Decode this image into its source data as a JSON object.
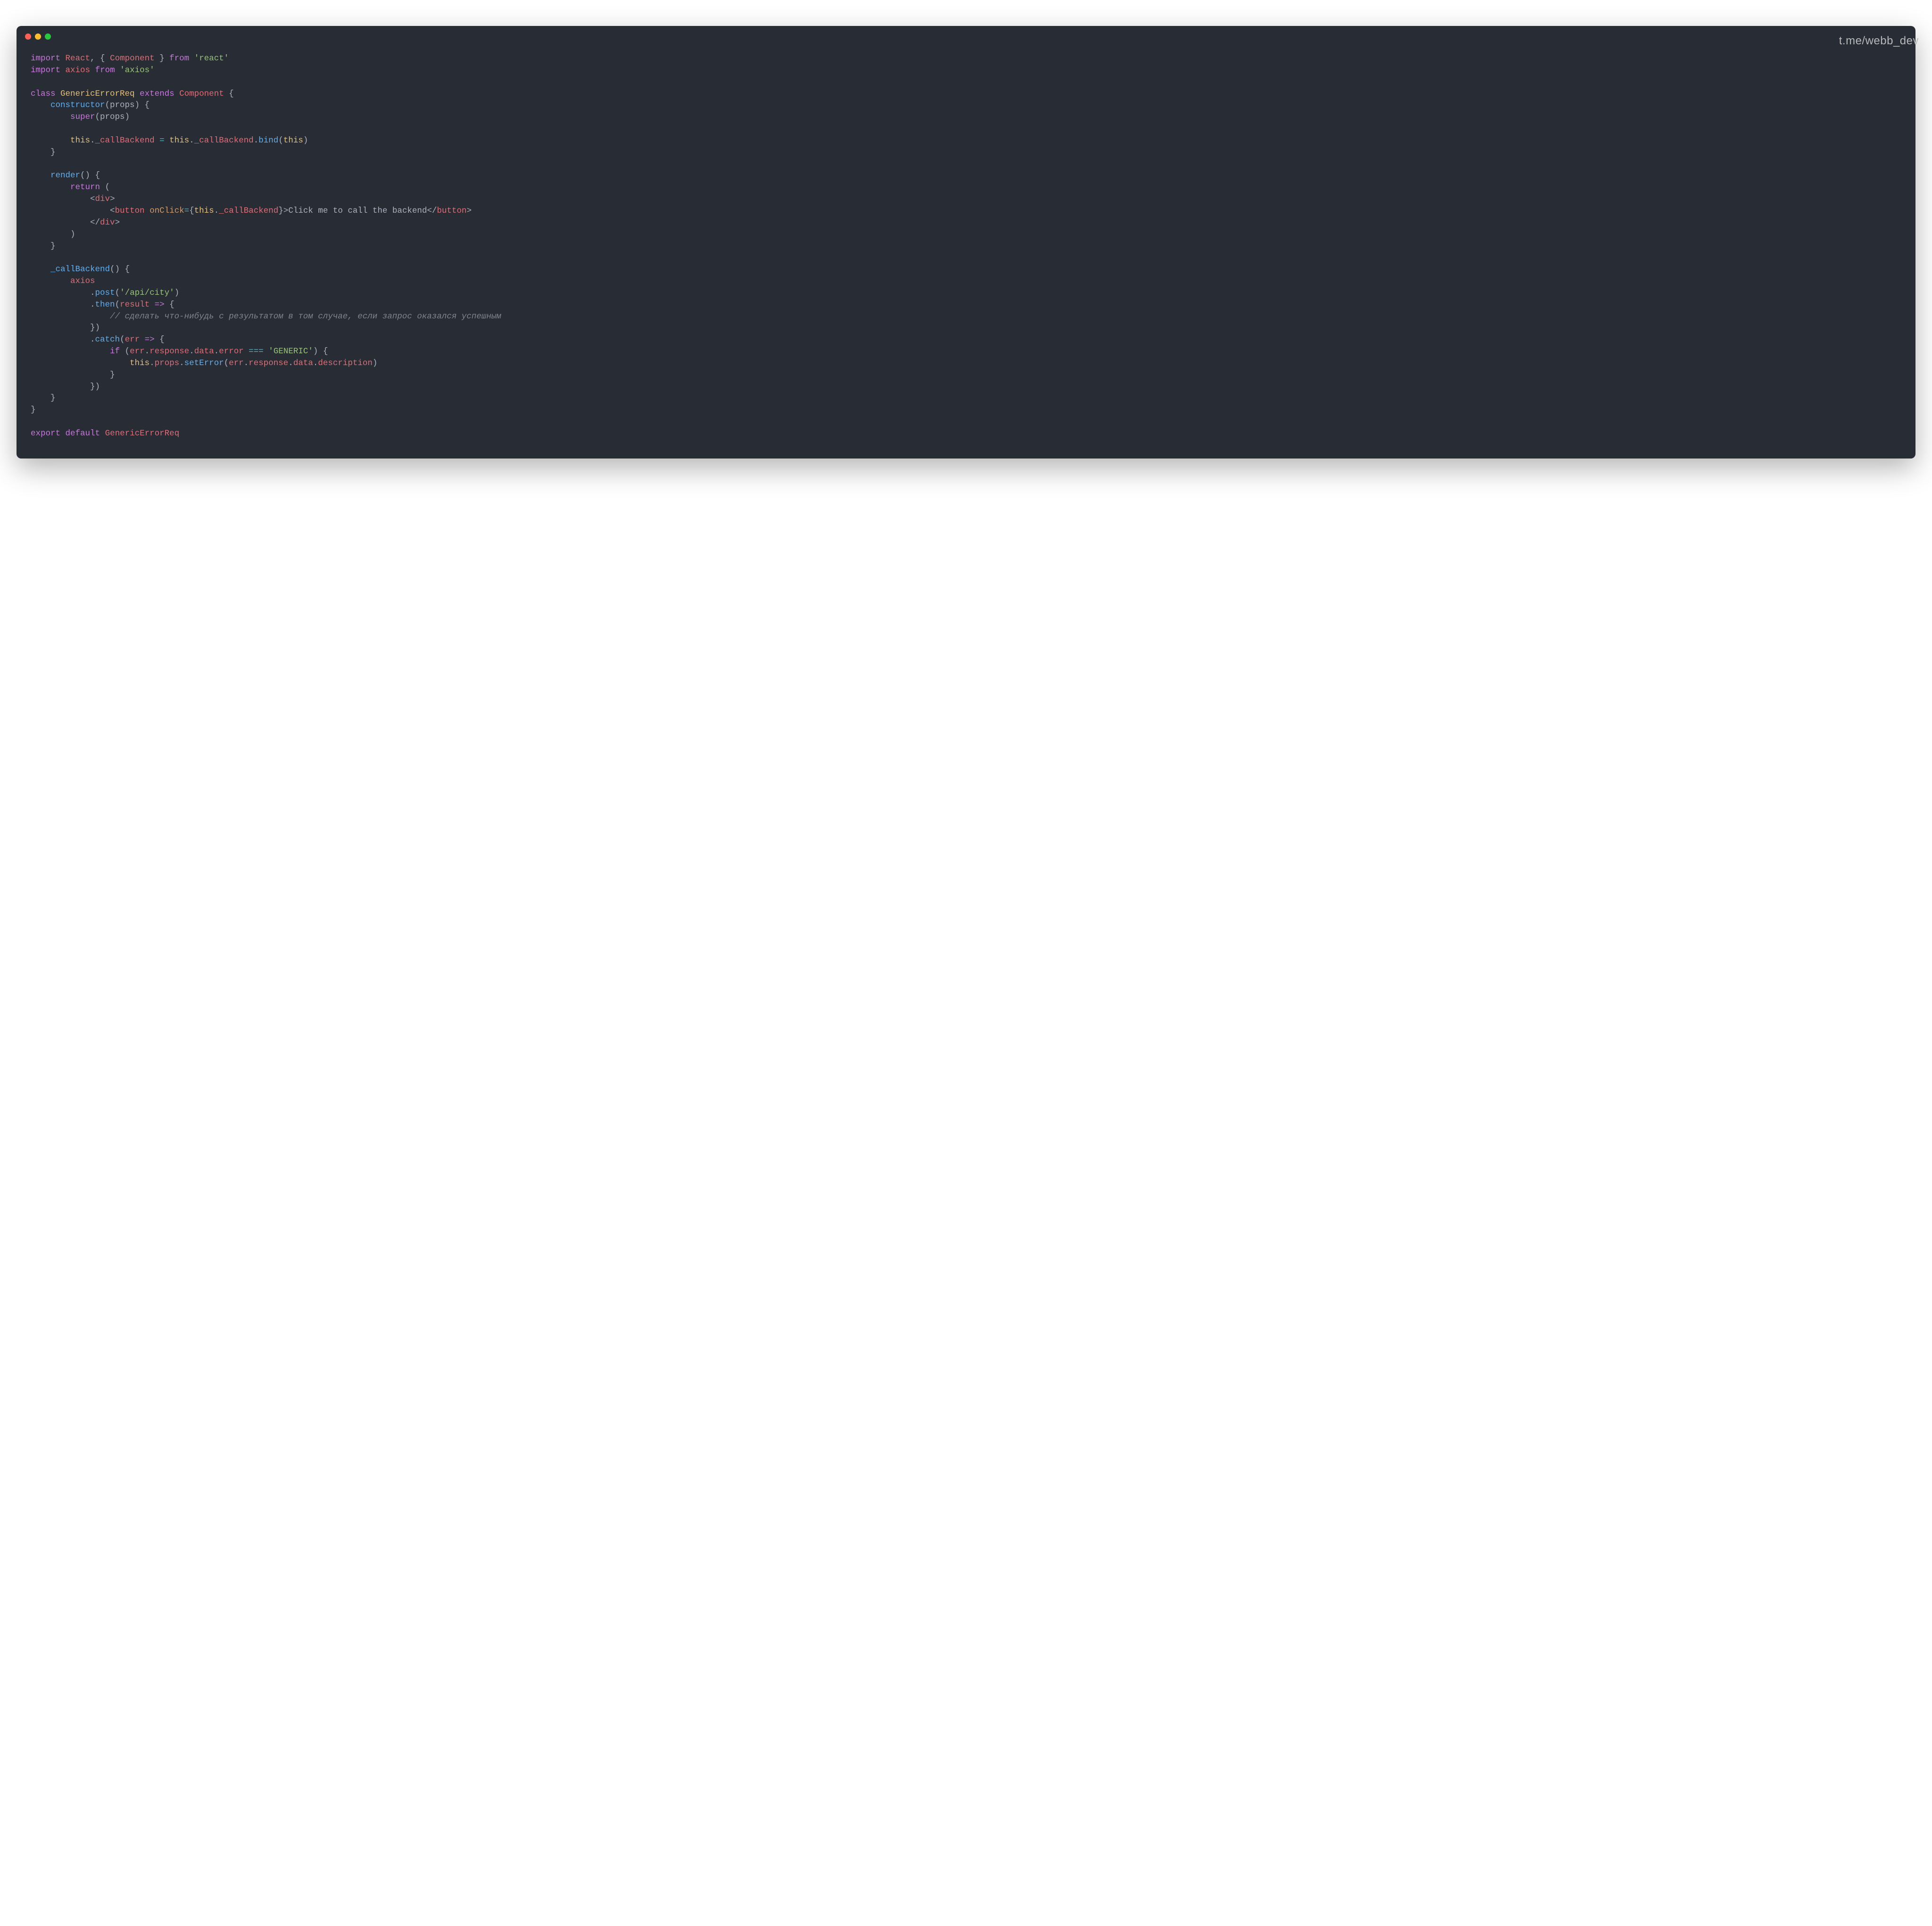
{
  "watermark": "t.me/webb_dev",
  "code": {
    "l1_import": "import",
    "l1_react": "React",
    "l1_comma": ", { ",
    "l1_component": "Component",
    "l1_brace_close": " } ",
    "l1_from": "from",
    "l1_react_str": "'react'",
    "l2_import": "import",
    "l2_axios": "axios",
    "l2_from": "from",
    "l2_axios_str": "'axios'",
    "l4_class": "class",
    "l4_name": "GenericErrorReq",
    "l4_extends": "extends",
    "l4_component": "Component",
    "l4_brace": " {",
    "l5_indent": "    ",
    "l5_constructor": "constructor",
    "l5_params": "(props) {",
    "l6_indent": "        ",
    "l6_super": "super",
    "l6_args": "(props)",
    "l8_indent": "        ",
    "l8_this1": "this",
    "l8_dot1": ".",
    "l8_prop1": "_callBackend",
    "l8_eq": " = ",
    "l8_this2": "this",
    "l8_dot2": ".",
    "l8_prop2": "_callBackend",
    "l8_dot3": ".",
    "l8_bind": "bind",
    "l8_open": "(",
    "l8_this3": "this",
    "l8_close": ")",
    "l9_indent": "    ",
    "l9_brace": "}",
    "l11_indent": "    ",
    "l11_render": "render",
    "l11_rest": "() {",
    "l12_indent": "        ",
    "l12_return": "return",
    "l12_paren": " (",
    "l13_indent": "            ",
    "l13_open": "<",
    "l13_div": "div",
    "l13_close": ">",
    "l14_indent": "                ",
    "l14_open": "<",
    "l14_button": "button",
    "l14_sp": " ",
    "l14_onclick": "onClick",
    "l14_eq": "=",
    "l14_brace_o": "{",
    "l14_this": "this",
    "l14_dot": ".",
    "l14_prop": "_callBackend",
    "l14_brace_c": "}",
    "l14_gt": ">",
    "l14_text": "Click me to call the backend",
    "l14_close_o": "</",
    "l14_close_tag": "button",
    "l14_close_c": ">",
    "l15_indent": "            ",
    "l15_open": "</",
    "l15_div": "div",
    "l15_close": ">",
    "l16_indent": "        ",
    "l16_paren": ")",
    "l17_indent": "    ",
    "l17_brace": "}",
    "l19_indent": "    ",
    "l19_method": "_callBackend",
    "l19_rest": "() {",
    "l20_indent": "        ",
    "l20_axios": "axios",
    "l21_indent": "            ",
    "l21_dot": ".",
    "l21_post": "post",
    "l21_open": "(",
    "l21_str": "'/api/city'",
    "l21_close": ")",
    "l22_indent": "            ",
    "l22_dot": ".",
    "l22_then": "then",
    "l22_open": "(",
    "l22_param": "result",
    "l22_arrow": " => ",
    "l22_brace": "{",
    "l23_indent": "                ",
    "l23_comment": "// сделать что-нибудь с результатом в том случае, если запрос оказался успешным",
    "l24_indent": "            ",
    "l24_brace": "})",
    "l25_indent": "            ",
    "l25_dot": ".",
    "l25_catch": "catch",
    "l25_open": "(",
    "l25_param": "err",
    "l25_arrow": " => ",
    "l25_brace": "{",
    "l26_indent": "                ",
    "l26_if": "if",
    "l26_open": " (",
    "l26_err": "err",
    "l26_d1": ".",
    "l26_resp": "response",
    "l26_d2": ".",
    "l26_data": "data",
    "l26_d3": ".",
    "l26_error": "error",
    "l26_eq": " === ",
    "l26_str": "'GENERIC'",
    "l26_close": ") {",
    "l27_indent": "                    ",
    "l27_this": "this",
    "l27_d1": ".",
    "l27_props": "props",
    "l27_d2": ".",
    "l27_setError": "setError",
    "l27_open": "(",
    "l27_err": "err",
    "l27_d3": ".",
    "l27_resp": "response",
    "l27_d4": ".",
    "l27_data": "data",
    "l27_d5": ".",
    "l27_desc": "description",
    "l27_close": ")",
    "l28_indent": "                ",
    "l28_brace": "}",
    "l29_indent": "            ",
    "l29_brace": "})",
    "l30_indent": "    ",
    "l30_brace": "}",
    "l31_brace": "}",
    "l33_export": "export",
    "l33_default": "default",
    "l33_name": "GenericErrorReq"
  }
}
